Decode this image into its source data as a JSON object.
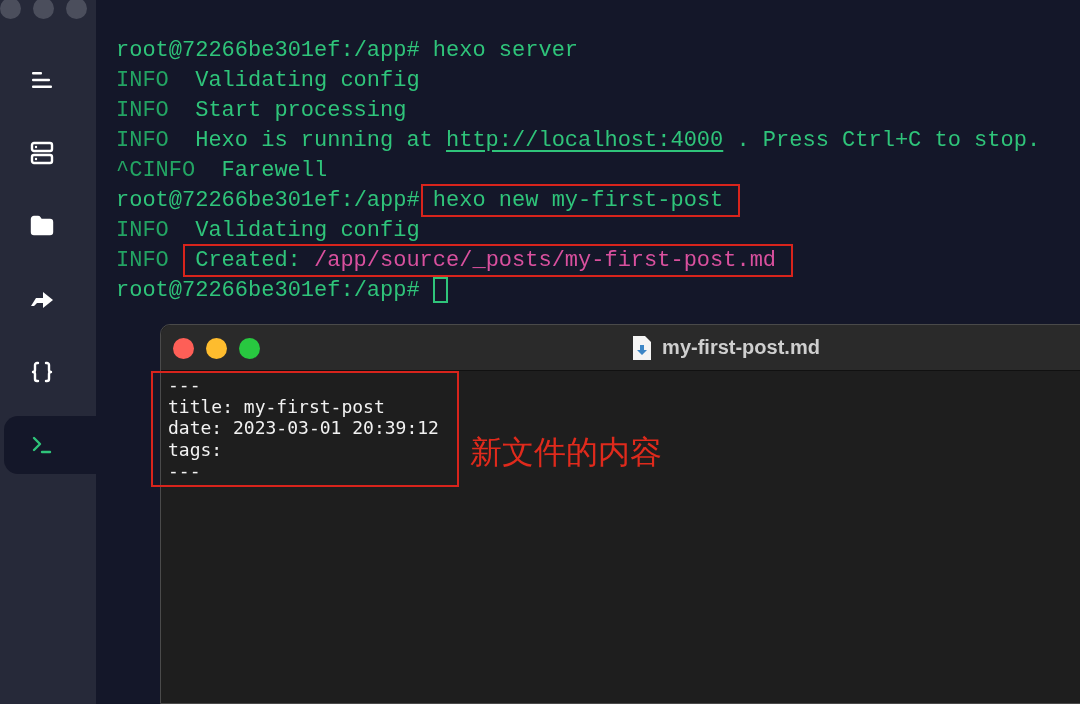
{
  "sidebar": {
    "items": [
      {
        "kind": "menu",
        "selected": false
      },
      {
        "kind": "server",
        "selected": false
      },
      {
        "kind": "folder",
        "selected": false
      },
      {
        "kind": "forward",
        "selected": false
      },
      {
        "kind": "braces",
        "selected": false
      },
      {
        "kind": "terminal",
        "selected": true
      }
    ]
  },
  "terminal": {
    "lines": [
      {
        "segments": [
          {
            "kind": "prompt",
            "text": "root@72266be301ef:/app#"
          },
          {
            "kind": "command",
            "text": "hexo server"
          }
        ]
      },
      {
        "segments": [
          {
            "kind": "info",
            "text": "INFO"
          },
          {
            "kind": "message",
            "text": "Validating config"
          }
        ]
      },
      {
        "segments": [
          {
            "kind": "info",
            "text": "INFO"
          },
          {
            "kind": "message",
            "text": "Start processing"
          }
        ]
      },
      {
        "segments": [
          {
            "kind": "info",
            "text": "INFO"
          },
          {
            "kind": "message",
            "text": "Hexo is running at"
          },
          {
            "kind": "link",
            "text": "http://localhost:4000"
          },
          {
            "kind": "message",
            "text": ". Press Ctrl+C to stop."
          }
        ]
      },
      {
        "segments": [
          {
            "kind": "info",
            "text": "^CINFO"
          },
          {
            "kind": "message",
            "text": "Farewell"
          }
        ]
      },
      {
        "segments": [
          {
            "kind": "prompt",
            "text": "root@72266be301ef:/app#"
          },
          {
            "kind": "boxed",
            "parts": [
              {
                "kind": "command",
                "text": "hexo new my-first-post"
              }
            ]
          }
        ]
      },
      {
        "segments": [
          {
            "kind": "info",
            "text": "INFO"
          },
          {
            "kind": "message",
            "text": "Validating config"
          }
        ]
      },
      {
        "segments": [
          {
            "kind": "info",
            "text": "INFO"
          },
          {
            "kind": "boxed",
            "parts": [
              {
                "kind": "message",
                "text": "Created:"
              },
              {
                "kind": "path",
                "text": "/app/source/_posts/my-first-post.md"
              }
            ]
          }
        ]
      },
      {
        "segments": [
          {
            "kind": "prompt",
            "text": "root@72266be301ef:/app#"
          },
          {
            "kind": "cursor"
          }
        ]
      }
    ]
  },
  "editor": {
    "title": "my-first-post.md",
    "lines": [
      "---",
      "title: my-first-post",
      "date: 2023-03-01 20:39:12",
      "tags:",
      "---"
    ],
    "annotation": "新文件的内容"
  }
}
